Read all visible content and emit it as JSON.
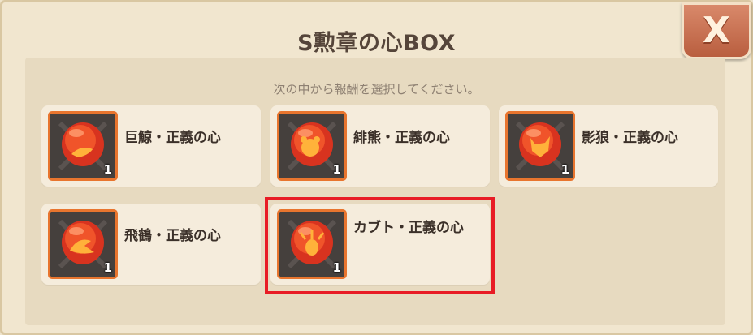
{
  "dialog": {
    "title": "S勲章の心BOX",
    "close_label": "X",
    "instruction": "次の中から報酬を選択してください。"
  },
  "rewards": [
    {
      "label": "巨鯨・正義の心",
      "quantity": "1",
      "icon": "whale-gem-icon"
    },
    {
      "label": "緋熊・正義の心",
      "quantity": "1",
      "icon": "bear-gem-icon"
    },
    {
      "label": "影狼・正義の心",
      "quantity": "1",
      "icon": "wolf-gem-icon"
    },
    {
      "label": "飛鶴・正義の心",
      "quantity": "1",
      "icon": "crane-gem-icon"
    },
    {
      "label": "カブト・正義の心",
      "quantity": "1",
      "icon": "beetle-gem-icon",
      "selected": true
    }
  ],
  "colors": {
    "accent": "#e8752e",
    "selection": "#e81c25",
    "close_button": "#c8704f"
  }
}
